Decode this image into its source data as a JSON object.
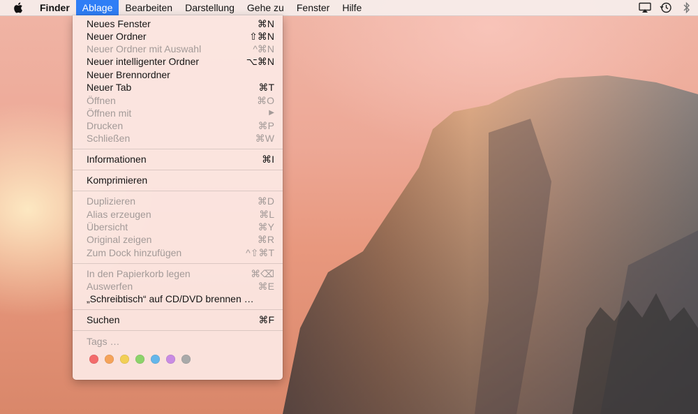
{
  "menubar": {
    "items": [
      "Finder",
      "Ablage",
      "Bearbeiten",
      "Darstellung",
      "Gehe zu",
      "Fenster",
      "Hilfe"
    ],
    "active": "Ablage"
  },
  "menu": {
    "items": [
      {
        "label": "Neues Fenster",
        "shortcut": "⌘N",
        "enabled": true
      },
      {
        "label": "Neuer Ordner",
        "shortcut": "⇧⌘N",
        "enabled": true
      },
      {
        "label": "Neuer Ordner mit Auswahl",
        "shortcut": "^⌘N",
        "enabled": false
      },
      {
        "label": "Neuer intelligenter Ordner",
        "shortcut": "⌥⌘N",
        "enabled": true
      },
      {
        "label": "Neuer Brennordner",
        "shortcut": "",
        "enabled": true
      },
      {
        "label": "Neuer Tab",
        "shortcut": "⌘T",
        "enabled": true
      },
      {
        "label": "Öffnen",
        "shortcut": "⌘O",
        "enabled": false
      },
      {
        "label": "Öffnen mit",
        "shortcut": "▶",
        "enabled": false
      },
      {
        "label": "Drucken",
        "shortcut": "⌘P",
        "enabled": false
      },
      {
        "label": "Schließen",
        "shortcut": "⌘W",
        "enabled": false
      },
      {
        "label": "Informationen",
        "shortcut": "⌘I",
        "enabled": true
      },
      {
        "label": "Komprimieren",
        "shortcut": "",
        "enabled": true
      },
      {
        "label": "Duplizieren",
        "shortcut": "⌘D",
        "enabled": false
      },
      {
        "label": "Alias erzeugen",
        "shortcut": "⌘L",
        "enabled": false
      },
      {
        "label": "Übersicht",
        "shortcut": "⌘Y",
        "enabled": false
      },
      {
        "label": "Original zeigen",
        "shortcut": "⌘R",
        "enabled": false
      },
      {
        "label": "Zum Dock hinzufügen",
        "shortcut": "^⇧⌘T",
        "enabled": false
      },
      {
        "label": "In den Papierkorb legen",
        "shortcut": "⌘⌫",
        "enabled": false
      },
      {
        "label": "Auswerfen",
        "shortcut": "⌘E",
        "enabled": false
      },
      {
        "label": "„Schreibtisch“ auf CD/DVD brennen …",
        "shortcut": "",
        "enabled": true
      },
      {
        "label": "Suchen",
        "shortcut": "⌘F",
        "enabled": true
      },
      {
        "label": "Tags …",
        "shortcut": "",
        "enabled": false
      }
    ],
    "tag_colors": [
      "#f36b6b",
      "#f5a35a",
      "#f2cf55",
      "#8cd36a",
      "#64b6ea",
      "#c98be3",
      "#a9a9a9"
    ]
  },
  "status_icons": [
    "airplay-icon",
    "time-machine-icon",
    "bluetooth-icon"
  ]
}
